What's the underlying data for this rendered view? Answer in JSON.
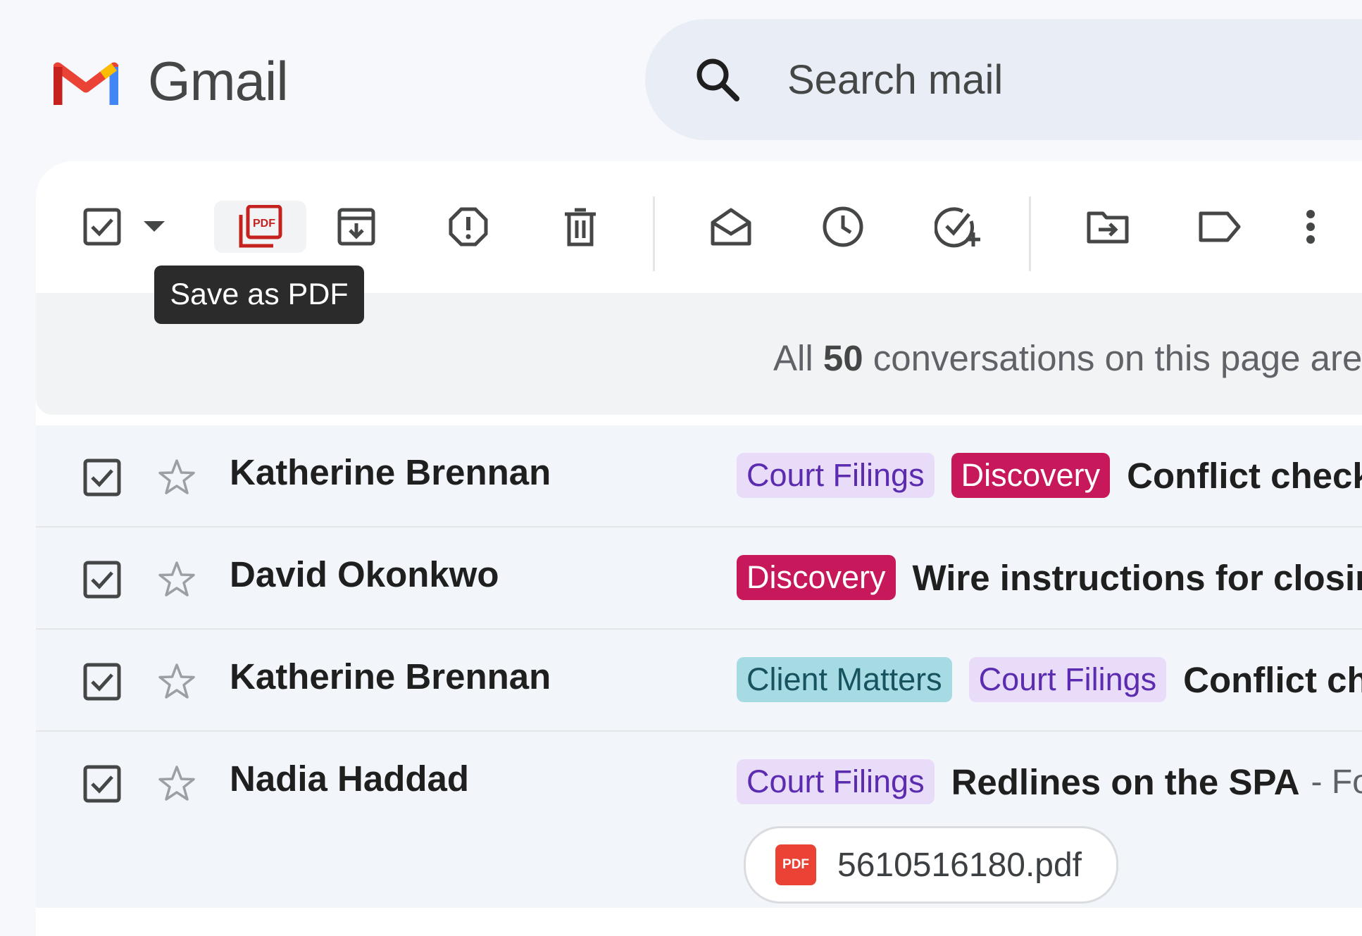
{
  "app": {
    "name": "Gmail"
  },
  "search": {
    "placeholder": "Search mail"
  },
  "toolbar": {
    "tooltip": "Save as PDF",
    "buttons": [
      "select",
      "select-menu",
      "save-as-pdf",
      "archive",
      "report-spam",
      "delete",
      "mark-as-read",
      "snooze",
      "add-to-tasks",
      "move-to",
      "labels",
      "more"
    ]
  },
  "banner": {
    "prefix": "All",
    "count": "50",
    "suffix": "conversations on this page are"
  },
  "rows": [
    {
      "sender": "Katherine Brennan",
      "labels": [
        {
          "text": "Court Filings",
          "kind": "court"
        },
        {
          "text": "Discovery",
          "kind": "disc"
        }
      ],
      "subject": "Conflict check",
      "snippet": ""
    },
    {
      "sender": "David Okonkwo",
      "labels": [
        {
          "text": "Discovery",
          "kind": "disc"
        }
      ],
      "subject": "Wire instructions for closing",
      "snippet": ""
    },
    {
      "sender": "Katherine Brennan",
      "labels": [
        {
          "text": "Client Matters",
          "kind": "client"
        },
        {
          "text": "Court Filings",
          "kind": "court"
        }
      ],
      "subject": "Conflict check",
      "snippet": ""
    },
    {
      "sender": "Nadia Haddad",
      "labels": [
        {
          "text": "Court Filings",
          "kind": "court"
        }
      ],
      "subject": "Redlines on the SPA",
      "snippet": "- Fo",
      "attachment": {
        "icon_text": "PDF",
        "filename": "5610516180.pdf"
      }
    }
  ],
  "colors": {
    "court_bg": "#e8dcf9",
    "court_fg": "#5b2bb0",
    "disc_bg": "#c7185c",
    "disc_fg": "#ffffff",
    "client_bg": "#a6dbe4",
    "client_fg": "#17535f"
  }
}
